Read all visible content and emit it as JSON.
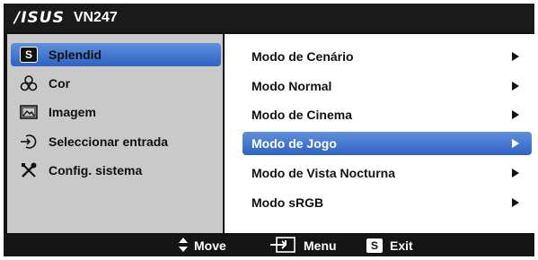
{
  "header": {
    "brand": "/ISUS",
    "model": "VN247"
  },
  "sidebar": {
    "items": [
      {
        "label": "Splendid",
        "icon": "splendid-s-icon",
        "selected": true
      },
      {
        "label": "Cor",
        "icon": "color-icon",
        "selected": false
      },
      {
        "label": "Imagem",
        "icon": "image-icon",
        "selected": false
      },
      {
        "label": "Seleccionar entrada",
        "icon": "input-select-icon",
        "selected": false
      },
      {
        "label": "Config. sistema",
        "icon": "tools-icon",
        "selected": false
      }
    ]
  },
  "submenu": {
    "items": [
      {
        "label": "Modo de Cenário",
        "selected": false
      },
      {
        "label": "Modo Normal",
        "selected": false
      },
      {
        "label": "Modo de Cinema",
        "selected": false
      },
      {
        "label": "Modo de Jogo",
        "selected": true
      },
      {
        "label": "Modo de Vista Nocturna",
        "selected": false
      },
      {
        "label": "Modo sRGB",
        "selected": false
      }
    ]
  },
  "footer": {
    "move_label": "Move",
    "menu_label": "Menu",
    "exit_label": "Exit",
    "exit_badge": "S"
  },
  "colors": {
    "highlight_top": "#5f8fdc",
    "highlight_bottom": "#2f63c4",
    "sidebar_bg": "#c9c9c9",
    "frame": "#111111"
  }
}
